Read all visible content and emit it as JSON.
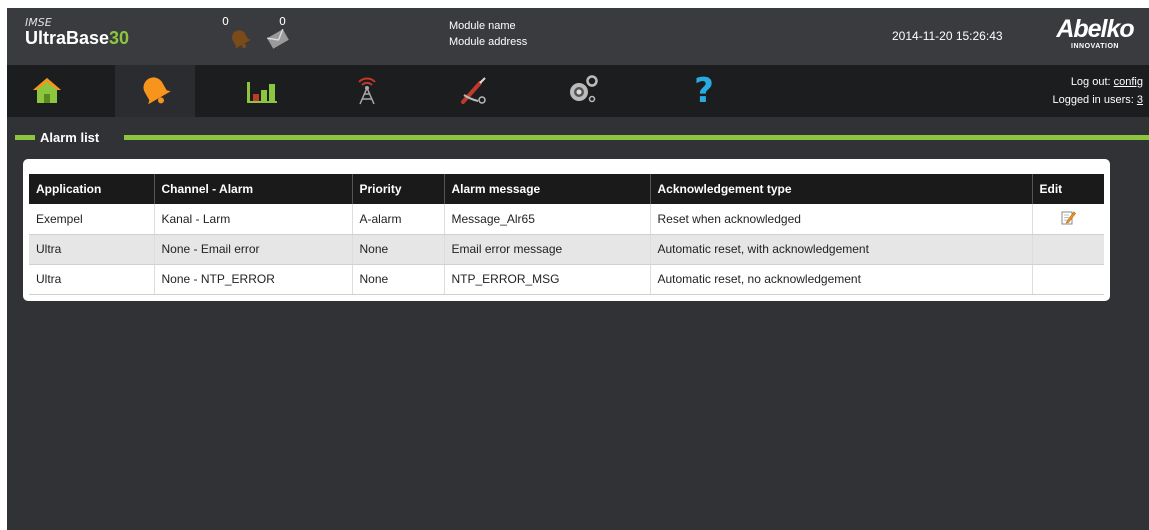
{
  "brand": {
    "small": "IMSE",
    "name": "UltraBase",
    "number": "30"
  },
  "counters": {
    "alarms": "0",
    "messages": "0"
  },
  "module": {
    "name": "Module name",
    "address": "Module address"
  },
  "datetime": "2014-11-20 15:26:43",
  "logo": {
    "main": "Abelko",
    "sub": "INNOVATION"
  },
  "nav": {
    "items": [
      "home-icon",
      "alarm-bell-icon",
      "bar-chart-icon",
      "antenna-icon",
      "tools-icon",
      "gears-icon",
      "help-icon"
    ],
    "help_symbol": "?"
  },
  "user": {
    "logout_label": "Log out:",
    "logout_user": "config",
    "logged_in_label": "Logged in users:",
    "logged_in_count": "3"
  },
  "section": {
    "title": "Alarm list"
  },
  "table": {
    "headers": {
      "application": "Application",
      "channel": "Channel - Alarm",
      "priority": "Priority",
      "message": "Alarm message",
      "ack": "Acknowledgement type",
      "edit": "Edit"
    },
    "rows": [
      {
        "application": "Exempel",
        "channel": "Kanal - Larm",
        "priority": "A-alarm",
        "message": "Message_Alr65",
        "ack": "Reset when acknowledged",
        "editable": true
      },
      {
        "application": "Ultra",
        "channel": "None - Email error",
        "priority": "None",
        "message": "Email error message",
        "ack": "Automatic reset, with acknowledgement",
        "editable": false
      },
      {
        "application": "Ultra",
        "channel": "None - NTP_ERROR",
        "priority": "None",
        "message": "NTP_ERROR_MSG",
        "ack": "Automatic reset, no acknowledgement",
        "editable": false
      }
    ]
  },
  "colors": {
    "accent": "#8cc63f",
    "alarm_orange": "#f7941d",
    "help_blue": "#29abe2"
  }
}
